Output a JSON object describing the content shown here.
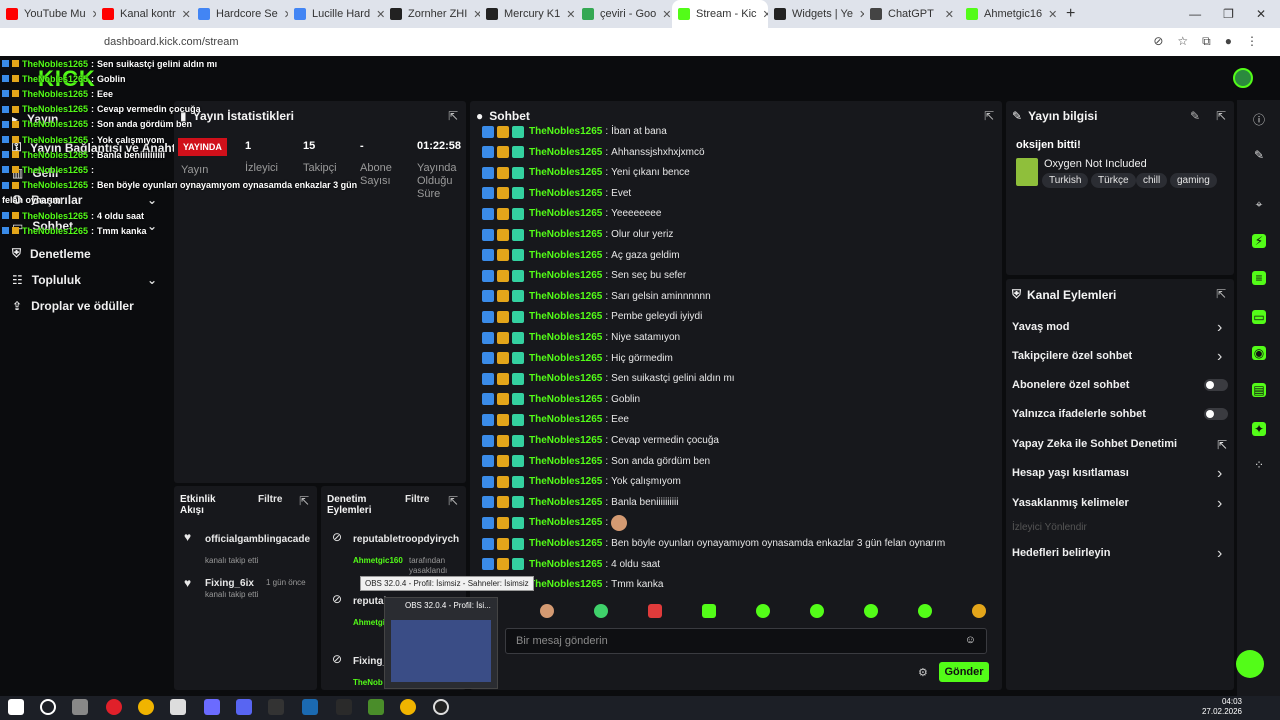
{
  "browser": {
    "tabs": [
      {
        "label": "YouTube Mu",
        "color": "#ff0000"
      },
      {
        "label": "Kanal kontr",
        "color": "#ff0000"
      },
      {
        "label": "Hardcore Se",
        "color": "#4285f4"
      },
      {
        "label": "Lucille Hard",
        "color": "#4285f4"
      },
      {
        "label": "Zornher ZHI",
        "color": "#222222"
      },
      {
        "label": "Mercury K1",
        "color": "#222222"
      },
      {
        "label": "çeviri - Goo",
        "color": "#34a853"
      },
      {
        "label": "Stream - Kic",
        "color": "#53fc18"
      },
      {
        "label": "Widgets | Ye",
        "color": "#222222"
      },
      {
        "label": "ChatGPT",
        "color": "#444444"
      },
      {
        "label": "Ahmetgic16",
        "color": "#53fc18"
      }
    ],
    "url": "dashboard.kick.com/stream",
    "new_tab": "+",
    "win_min": "—",
    "win_max": "❐",
    "win_close": "✕"
  },
  "overlay_chat": [
    {
      "user": "TheNobles1265",
      "msg": "Sen suikastçi gelini aldın mı"
    },
    {
      "user": "TheNobles1265",
      "msg": "Goblin"
    },
    {
      "user": "TheNobles1265",
      "msg": "Eee"
    },
    {
      "user": "TheNobles1265",
      "msg": "Cevap vermedin çocuğa"
    },
    {
      "user": "TheNobles1265",
      "msg": "Son anda gördüm ben"
    },
    {
      "user": "TheNobles1265",
      "msg": "Yok çalışmıyom"
    },
    {
      "user": "TheNobles1265",
      "msg": "Banla beniiiiiiiiii"
    },
    {
      "user": "TheNobles1265",
      "msg": ""
    },
    {
      "user": "TheNobles1265",
      "msg": "Ben böyle oyunları oynayamıyom oynasamda enkazlar 3 gün"
    },
    {
      "user": "",
      "msg": "felan oynarım"
    },
    {
      "user": "TheNobles1265",
      "msg": "4 oldu saat"
    },
    {
      "user": "TheNobles1265",
      "msg": "Tmm kanka"
    }
  ],
  "nav": {
    "logo": "KICK",
    "items": [
      {
        "label": "Yayın"
      },
      {
        "label": "Yayın Bağlantısı ve Anahtarı"
      },
      {
        "label": "Gelir"
      },
      {
        "label": "Başarılar"
      },
      {
        "label": "Sohbet"
      },
      {
        "label": "Denetleme"
      },
      {
        "label": "Topluluk"
      },
      {
        "label": "Droplar ve ödüller"
      }
    ]
  },
  "stats": {
    "title": "Yayın İstatistikleri",
    "live_badge": "YAYINDA",
    "live_label": "Yayın",
    "viewers_value": "1",
    "viewers_label": "İzleyici",
    "followers_value": "15",
    "followers_label": "Takipçi",
    "subs_value": "-",
    "subs_label": "Abone Sayısı",
    "uptime_value": "01:22:58",
    "uptime_label": "Yayında Olduğu Süre"
  },
  "activity": {
    "title": "Etkinlik Akışı",
    "filter": "Filtre",
    "items": [
      {
        "user": "officialgamblingacade",
        "action": "kanalı takip etti",
        "time": ""
      },
      {
        "user": "Fixing_6ix",
        "action": "kanalı takip etti",
        "time": "1 gün önce"
      }
    ]
  },
  "mod_actions": {
    "title": "Denetim Eylemleri",
    "filter": "Filtre",
    "items": [
      {
        "target": "reputabletroopdyirych",
        "by": "Ahmetgic160",
        "text": "tarafından yasaklandı"
      },
      {
        "target": "reputal",
        "by": "Ahmetgi",
        "text": "yasakl"
      },
      {
        "target": "Fixing_",
        "by": "TheNob",
        "text": "yasağı k"
      }
    ]
  },
  "chat": {
    "title": "Sohbet",
    "messages": [
      {
        "user": "TheNobles1265",
        "msg": "İban at bana"
      },
      {
        "user": "TheNobles1265",
        "msg": "Ahhanssjshxhxjxmcö"
      },
      {
        "user": "TheNobles1265",
        "msg": "Yeni çıkanı bence"
      },
      {
        "user": "TheNobles1265",
        "msg": "Evet"
      },
      {
        "user": "TheNobles1265",
        "msg": "Yeeeeeeee"
      },
      {
        "user": "TheNobles1265",
        "msg": "Olur olur yeriz"
      },
      {
        "user": "TheNobles1265",
        "msg": "Aç gaza geldim"
      },
      {
        "user": "TheNobles1265",
        "msg": "Sen seç bu sefer"
      },
      {
        "user": "TheNobles1265",
        "msg": "Sarı gelsin aminnnnnn"
      },
      {
        "user": "TheNobles1265",
        "msg": "Pembe geleydi iyiydi"
      },
      {
        "user": "TheNobles1265",
        "msg": "Niye satamıyon"
      },
      {
        "user": "TheNobles1265",
        "msg": "Hiç görmedim"
      },
      {
        "user": "TheNobles1265",
        "msg": "Sen suikastçi gelini aldın mı"
      },
      {
        "user": "TheNobles1265",
        "msg": "Goblin"
      },
      {
        "user": "TheNobles1265",
        "msg": "Eee"
      },
      {
        "user": "TheNobles1265",
        "msg": "Cevap vermedin çocuğa"
      },
      {
        "user": "TheNobles1265",
        "msg": "Son anda gördüm ben"
      },
      {
        "user": "TheNobles1265",
        "msg": "Yok çalışmıyom"
      },
      {
        "user": "TheNobles1265",
        "msg": "Banla beniiiiiiiiii"
      },
      {
        "user": "TheNobles1265",
        "msg": ""
      },
      {
        "user": "TheNobles1265",
        "msg": "Ben böyle oyunları oynayamıyom oynasamda enkazlar 3 gün felan oynarım"
      },
      {
        "user": "TheNobles1265",
        "msg": "4 oldu saat"
      },
      {
        "user": "TheNobles1265",
        "msg": "Tmm kanka"
      }
    ],
    "placeholder": "Bir mesaj gönderin",
    "send": "Gönder"
  },
  "info": {
    "title": "Yayın bilgisi",
    "stream_title": "oksijen bitti!",
    "game": "Oxygen Not Included",
    "tags": [
      "Turkish",
      "Türkçe",
      "chill",
      "gaming"
    ]
  },
  "channel_actions": {
    "title": "Kanal Eylemleri",
    "items": [
      {
        "label": "Yavaş mod",
        "kind": "chevron"
      },
      {
        "label": "Takipçilere özel sohbet",
        "kind": "chevron"
      },
      {
        "label": "Abonelere özel sohbet",
        "kind": "toggle"
      },
      {
        "label": "Yalnızca ifadelerle sohbet",
        "kind": "toggle"
      },
      {
        "label": "Yapay Zeka ile Sohbet Denetimi",
        "kind": "external"
      },
      {
        "label": "Hesap yaşı kısıtlaması",
        "kind": "chevron"
      },
      {
        "label": "Yasaklanmış kelimeler",
        "kind": "chevron"
      },
      {
        "label": "İzleyici Yönlendir",
        "kind": "disabled"
      },
      {
        "label": "Hedefleri belirleyin",
        "kind": "chevron"
      }
    ]
  },
  "obs": {
    "tooltip": "OBS 32.0.4 - Profil: İsimsiz - Sahneler: İsimsiz",
    "thumb_title": "OBS 32.0.4 - Profil: İsi..."
  },
  "clock": {
    "time": "04:03",
    "date": "27.02.2026"
  }
}
